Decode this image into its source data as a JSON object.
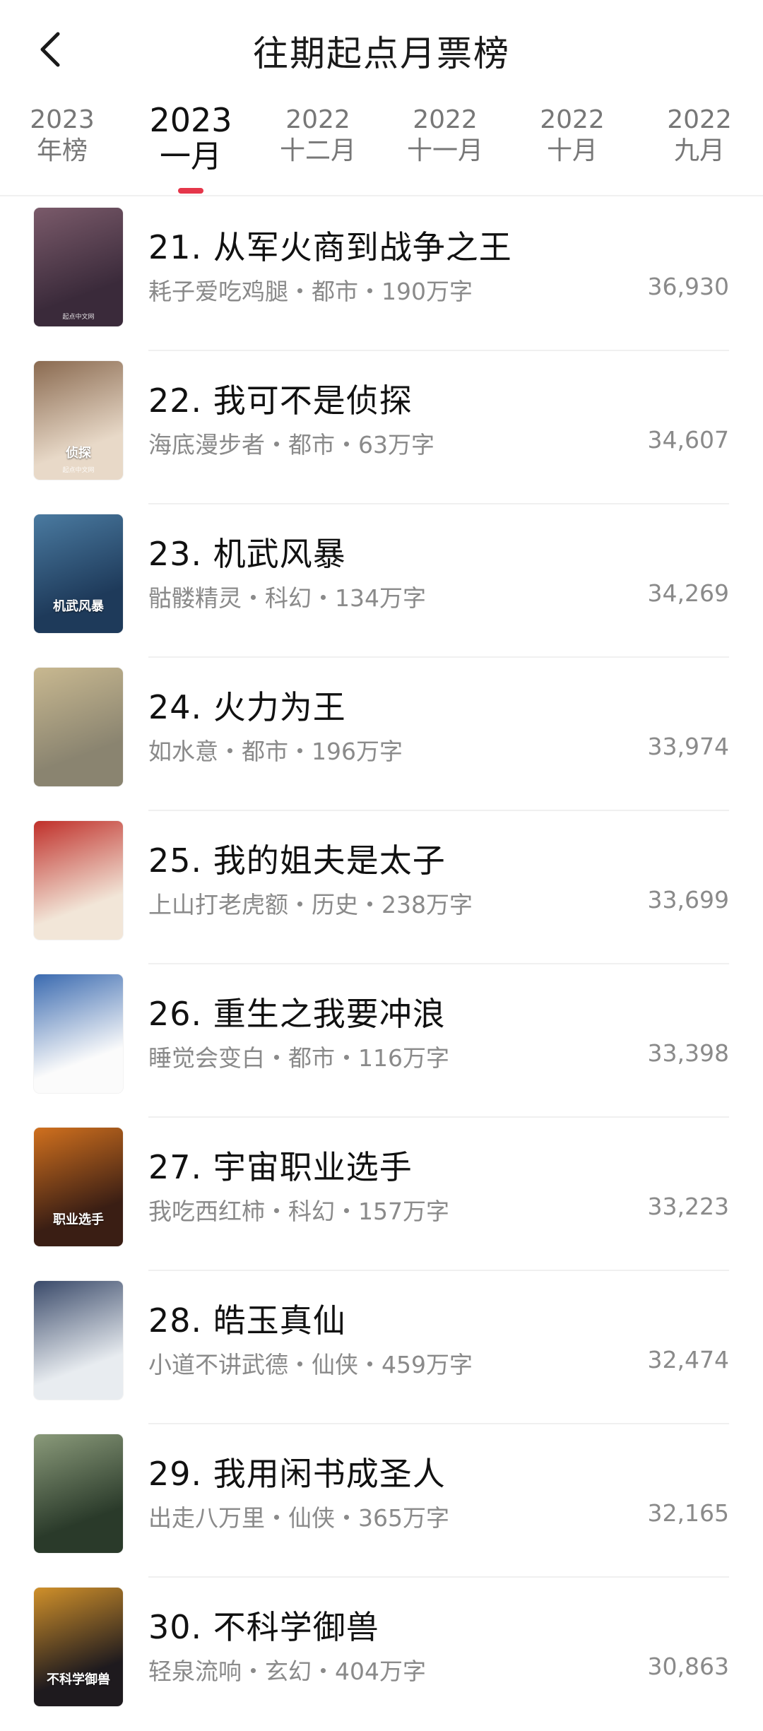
{
  "header": {
    "title": "往期起点月票榜",
    "back_icon": "chevron-left-icon"
  },
  "tabs": [
    {
      "year": "2023",
      "month": "年榜",
      "active": false
    },
    {
      "year": "2023",
      "month": "一月",
      "active": true
    },
    {
      "year": "2022",
      "month": "十二月",
      "active": false
    },
    {
      "year": "2022",
      "month": "十一月",
      "active": false
    },
    {
      "year": "2022",
      "month": "十月",
      "active": false
    },
    {
      "year": "2022",
      "month": "九月",
      "active": false
    }
  ],
  "colors": {
    "accent": "#e5364a",
    "text_primary": "#111111",
    "text_secondary": "#8a8a8a"
  },
  "books": [
    {
      "title": "21. 从军火商到战争之王",
      "meta": "耗子爱吃鸡腿・都市・190万字",
      "votes": "36,930",
      "cover_bg": "#3a2a3a",
      "cover_accent": "#7a5a6a",
      "cover_label": "",
      "cover_pub": "起点中文网"
    },
    {
      "title": "22. 我可不是侦探",
      "meta": "海底漫步者・都市・63万字",
      "votes": "34,607",
      "cover_bg": "#e8d9c8",
      "cover_accent": "#8a6a50",
      "cover_label": "侦探",
      "cover_pub": "起点中文网"
    },
    {
      "title": "23. 机武风暴",
      "meta": "骷髅精灵・科幻・134万字",
      "votes": "34,269",
      "cover_bg": "#1e3a5a",
      "cover_accent": "#4a7aa0",
      "cover_label": "机武风暴",
      "cover_pub": ""
    },
    {
      "title": "24. 火力为王",
      "meta": "如水意・都市・196万字",
      "votes": "33,974",
      "cover_bg": "#8a8470",
      "cover_accent": "#c8b890",
      "cover_label": "",
      "cover_pub": ""
    },
    {
      "title": "25. 我的姐夫是太子",
      "meta": "上山打老虎额・历史・238万字",
      "votes": "33,699",
      "cover_bg": "#f2e6d8",
      "cover_accent": "#c0302a",
      "cover_label": "",
      "cover_pub": ""
    },
    {
      "title": "26. 重生之我要冲浪",
      "meta": "睡觉会变白・都市・116万字",
      "votes": "33,398",
      "cover_bg": "#fbfbfb",
      "cover_accent": "#3a6ab0",
      "cover_label": "",
      "cover_pub": ""
    },
    {
      "title": "27. 宇宙职业选手",
      "meta": "我吃西红柿・科幻・157万字",
      "votes": "33,223",
      "cover_bg": "#3a1e14",
      "cover_accent": "#d0701e",
      "cover_label": "职业选手",
      "cover_pub": ""
    },
    {
      "title": "28. 皓玉真仙",
      "meta": "小道不讲武德・仙侠・459万字",
      "votes": "32,474",
      "cover_bg": "#e8ecf0",
      "cover_accent": "#3a4a6a",
      "cover_label": "",
      "cover_pub": ""
    },
    {
      "title": "29. 我用闲书成圣人",
      "meta": "出走八万里・仙侠・365万字",
      "votes": "32,165",
      "cover_bg": "#2a3a2a",
      "cover_accent": "#8a9a7a",
      "cover_label": "",
      "cover_pub": ""
    },
    {
      "title": "30. 不科学御兽",
      "meta": "轻泉流响・玄幻・404万字",
      "votes": "30,863",
      "cover_bg": "#1e1a1e",
      "cover_accent": "#d0902a",
      "cover_label": "不科学御兽",
      "cover_pub": ""
    }
  ]
}
